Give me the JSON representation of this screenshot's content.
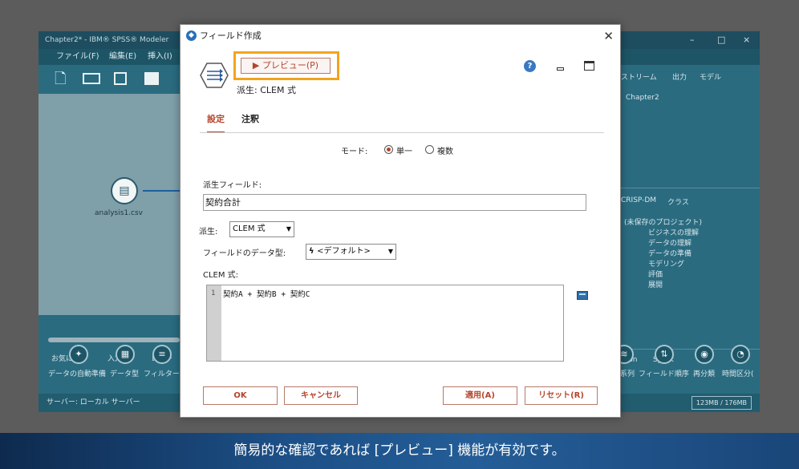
{
  "background_app": {
    "title": "Chapter2* - IBM® SPSS® Modeler",
    "window_controls": [
      "–",
      "□",
      "×"
    ],
    "menu": [
      "ファイル(F)",
      "編集(E)",
      "挿入(I)"
    ],
    "toolbar_icons": [
      "new-file-icon",
      "open-folder-icon",
      "save-icon",
      "print-icon"
    ],
    "canvas_node": {
      "label": "analysis1.csv"
    },
    "palette_tabs": [
      "お気に入り",
      "入力",
      "レコー"
    ],
    "palette_items": [
      "データの自動準備",
      "データ型",
      "フィルター"
    ],
    "right_palette_tabs": [
      "thon",
      "Spark"
    ],
    "right_palette_items": [
      "系列",
      "フィールド順序",
      "再分類",
      "時間区分("
    ],
    "status": {
      "server": "サーバー: ローカル サーバー",
      "memory": "123MB / 176MB"
    },
    "right_pane": {
      "tabs": [
        "ストリーム",
        "出力",
        "モデル"
      ],
      "stream_item": "Chapter2",
      "crisp_tabs": [
        "CRISP-DM",
        "クラス"
      ],
      "tree_root": "(未保存のプロジェクト)",
      "tree_items": [
        "ビジネスの理解",
        "データの理解",
        "データの準備",
        "モデリング",
        "評価",
        "展開"
      ]
    }
  },
  "dialog": {
    "title": "フィールド作成",
    "preview_button": "プレビュー(P)",
    "node_type": "派生: CLEM 式",
    "tabs": [
      "設定",
      "注釈"
    ],
    "mode": {
      "label": "モード:",
      "options": [
        "単一",
        "複数"
      ],
      "selected": "単一"
    },
    "derive_field": {
      "label": "派生フィールド:",
      "value": "契約合計"
    },
    "derive_as": {
      "label": "派生:",
      "value": "CLEM 式"
    },
    "field_type": {
      "label": "フィールドのデータ型:",
      "value": "<デフォルト>"
    },
    "clem": {
      "label": "CLEM 式:",
      "line_number": "1",
      "expression": "契約A + 契約B + 契約C"
    },
    "buttons": {
      "ok": "OK",
      "cancel": "キャンセル",
      "apply": "適用(A)",
      "reset": "リセット(R)"
    }
  },
  "caption": "簡易的な確認であれば [プレビュー] 機能が有効です。",
  "colors": {
    "accent": "#b5452c",
    "highlight": "#f2a41d",
    "app_bg": "#2a6b80",
    "caption_band": "#1c4f86"
  }
}
